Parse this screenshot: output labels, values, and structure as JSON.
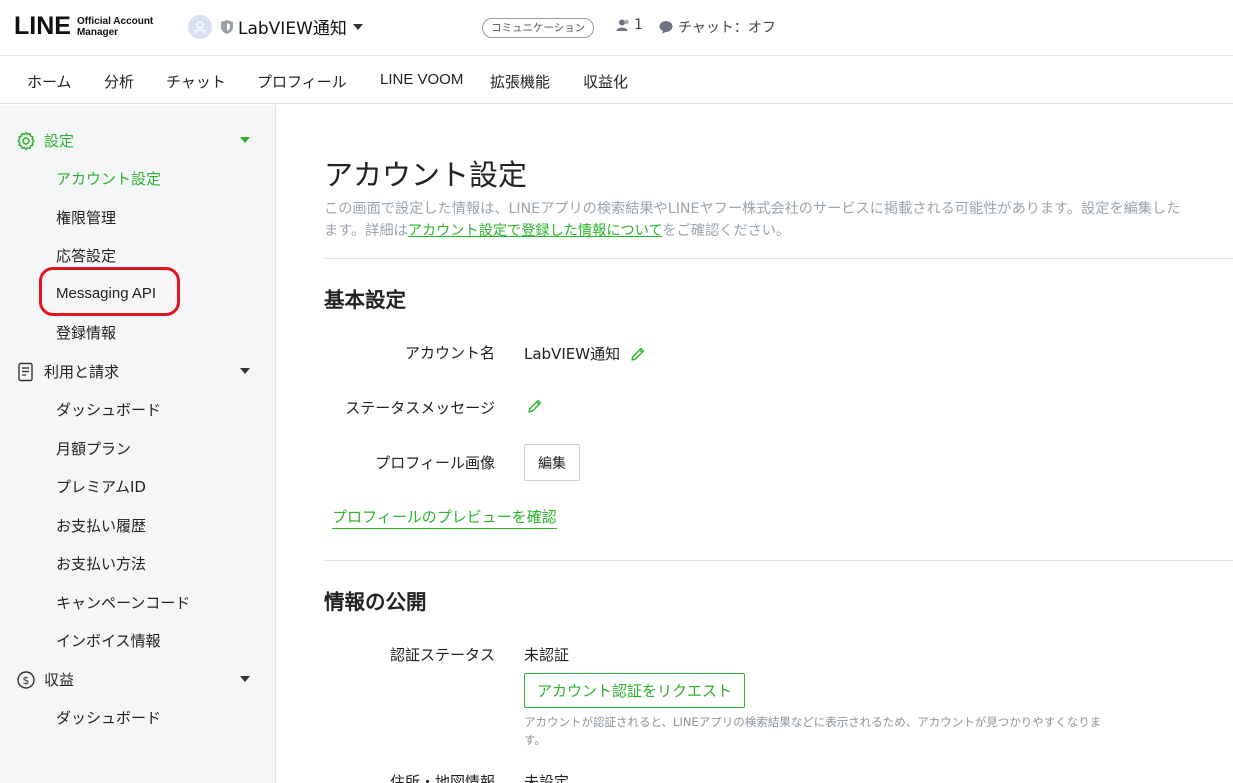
{
  "header": {
    "logo_main": "LINE",
    "logo_sub": "Official Account Manager",
    "account_name": "LabVIEW通知",
    "plan_badge": "コミュニケーション",
    "friends_count": "1",
    "chat_status": "チャット：オフ"
  },
  "nav": {
    "tabs": [
      "ホーム",
      "分析",
      "チャット",
      "プロフィール",
      "LINE VOOM",
      "拡張機能",
      "収益化"
    ]
  },
  "sidebar": {
    "sections": [
      {
        "label": "設定",
        "icon": "gear-icon",
        "items": [
          "アカウント設定",
          "権限管理",
          "応答設定",
          "Messaging API",
          "登録情報"
        ]
      },
      {
        "label": "利用と請求",
        "icon": "document-icon",
        "items": [
          "ダッシュボード",
          "月額プラン",
          "プレミアムID",
          "お支払い履歴",
          "お支払い方法",
          "キャンペーンコード",
          "インボイス情報"
        ]
      },
      {
        "label": "収益",
        "icon": "coin-icon",
        "items": [
          "ダッシュボード"
        ]
      }
    ],
    "active_item": "アカウント設定",
    "highlighted_item": "Messaging API"
  },
  "main": {
    "title": "アカウント設定",
    "description_pre": "この画面で設定した情報は、LINEアプリの検索結果やLINEヤフー株式会社のサービスに掲載される可能性があります。設定を編集した",
    "description_line2_pre": "ます。詳細は",
    "description_link": "アカウント設定で登録した情報について",
    "description_post": "をご確認ください。",
    "basic": {
      "heading": "基本設定",
      "account_name_label": "アカウント名",
      "account_name_value": "LabVIEW通知",
      "status_message_label": "ステータスメッセージ",
      "profile_image_label": "プロフィール画像",
      "edit_button": "編集",
      "preview_link": "プロフィールのプレビューを確認"
    },
    "publish": {
      "heading": "情報の公開",
      "verification_label": "認証ステータス",
      "verification_value": "未認証",
      "verify_button": "アカウント認証をリクエスト",
      "verify_note": "アカウントが認証されると、LINEアプリの検索結果などに表示されるため、アカウントが見つかりやすくなります。",
      "address_label": "住所・地図情報",
      "address_value": "未設定"
    }
  },
  "colors": {
    "accent": "#2bb32d",
    "highlight": "#e2141e",
    "sidebar_bg": "#f5f6f8"
  }
}
